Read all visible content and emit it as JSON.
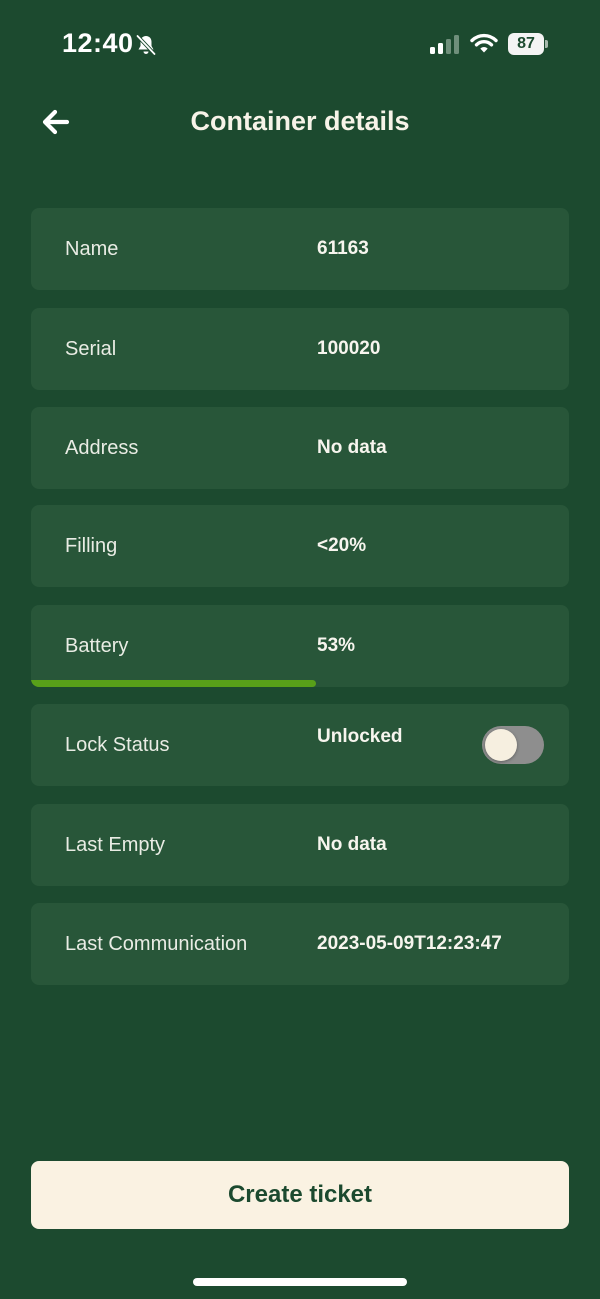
{
  "status_bar": {
    "time": "12:40",
    "battery_percent": "87",
    "icons": [
      "bell-slash-icon",
      "signal-icon",
      "wifi-icon",
      "battery-icon"
    ]
  },
  "header": {
    "title": "Container details",
    "back_icon": "arrow-left-icon"
  },
  "rows": [
    {
      "label": "Name",
      "value": "61163"
    },
    {
      "label": "Serial",
      "value": "100020"
    },
    {
      "label": "Address",
      "value": "No data"
    },
    {
      "label": "Filling",
      "value": "<20%"
    },
    {
      "label": "Battery",
      "value": "53%",
      "progress_percent": 53
    },
    {
      "label": "Lock Status",
      "value": "Unlocked",
      "toggle_on": false
    },
    {
      "label": "Last Empty",
      "value": "No data"
    },
    {
      "label": "Last Communication",
      "value": "2023-05-09T12:23:47"
    }
  ],
  "actions": {
    "create_ticket": "Create ticket"
  },
  "colors": {
    "background": "#1c4a2f",
    "card": "#285639",
    "progress": "#58a019",
    "button_bg": "#faf2e2",
    "toggle_off": "#8e8e8e"
  }
}
